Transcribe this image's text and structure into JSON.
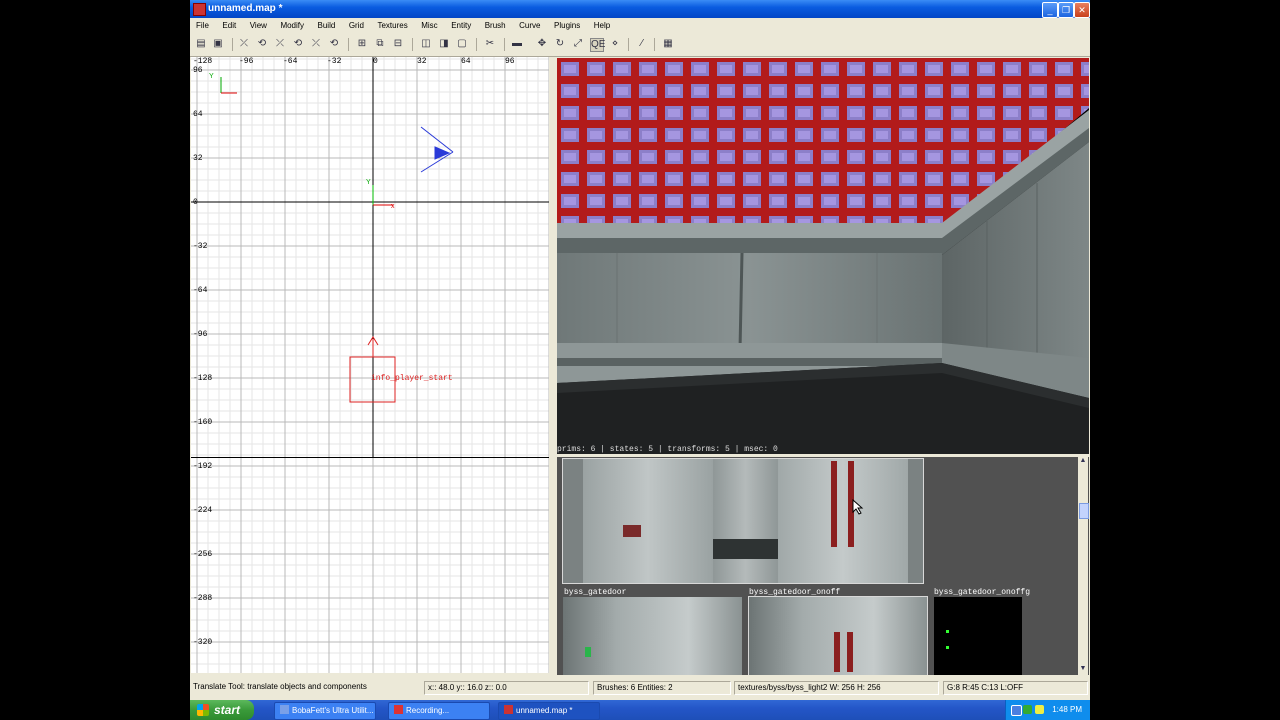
{
  "window": {
    "title": "unnamed.map *"
  },
  "menu": [
    "File",
    "Edit",
    "View",
    "Modify",
    "Build",
    "Grid",
    "Textures",
    "Misc",
    "Entity",
    "Brush",
    "Curve",
    "Plugins",
    "Help"
  ],
  "grid_view": {
    "x_labels": [
      "-128",
      "-96",
      "-64",
      "-32",
      "0",
      "32",
      "64",
      "96"
    ],
    "y_labels": [
      "96",
      "64",
      "32",
      "0",
      "-32",
      "-64",
      "-96",
      "-128",
      "-160"
    ],
    "y_labels_lower": [
      "-192",
      "-224",
      "-256",
      "-288",
      "-320"
    ],
    "axis_x_label": "x",
    "axis_y_label": "Y",
    "entity_label": "info_player_start"
  },
  "camera": {
    "status": "prims: 6 | states: 5 | transforms: 5 | msec: 0"
  },
  "textures": {
    "labels": [
      "byss_gatedoor",
      "byss_gatedoor_onoff",
      "byss_gatedoor_onoffg"
    ]
  },
  "statusbar": {
    "hint": "Translate Tool: translate objects and components",
    "coords": "x::  48.0  y::  16.0  z::   0.0",
    "counts": "Brushes: 6 Entities: 2",
    "texture": "textures/byss/byss_light2 W: 256 H: 256",
    "grid": "G:8  R:45  C:13  L:OFF"
  },
  "taskbar": {
    "start": "start",
    "tasks": [
      "BobaFett's Ultra Utilit...",
      "Recording...",
      "unnamed.map *"
    ],
    "clock": "1:48 PM"
  }
}
